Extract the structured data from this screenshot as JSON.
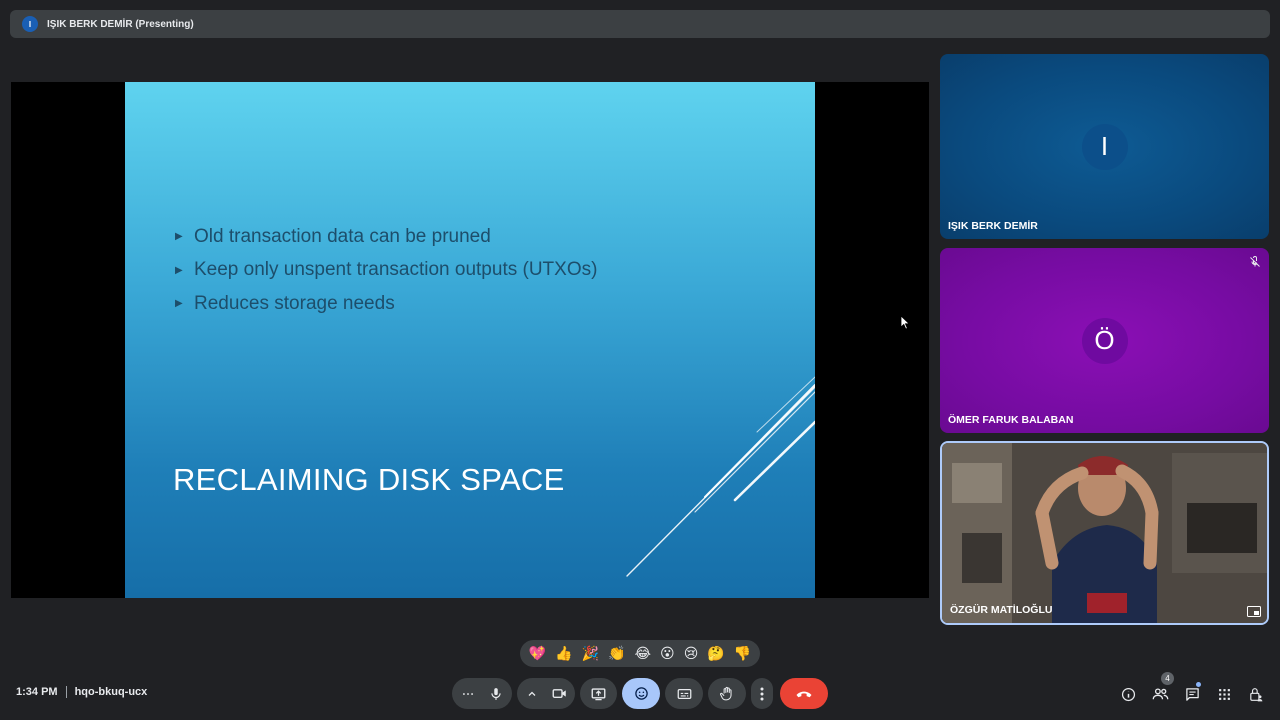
{
  "banner": {
    "avatar_initial": "I",
    "presenter_text": "IŞIK BERK DEMİR (Presenting)"
  },
  "slide": {
    "bullets": [
      "Old transaction data can be pruned",
      "Keep only unspent transaction outputs (UTXOs)",
      "Reduces storage needs"
    ],
    "title": "RECLAIMING DISK SPACE",
    "bullet_glyph": "▶"
  },
  "participants": [
    {
      "name": "IŞIK BERK DEMİR",
      "initial": "I",
      "color": "#0a4a7e"
    },
    {
      "name": "ÖMER FARUK BALABAN",
      "initial": "Ö",
      "color": "#770ca3",
      "muted": true
    },
    {
      "name": "ÖZGÜR MATİLOĞLU",
      "video": true
    }
  ],
  "reactions": [
    "💖",
    "👍",
    "🎉",
    "👏",
    "😂",
    "😮",
    "😢",
    "🤔",
    "👎"
  ],
  "meeting": {
    "time": "1:34 PM",
    "code": "hqo-bkuq-ucx"
  },
  "people_count": "4",
  "colors": {
    "accent": "#a8c7fa",
    "end_call": "#ea4335",
    "bar": "#3c4043"
  }
}
